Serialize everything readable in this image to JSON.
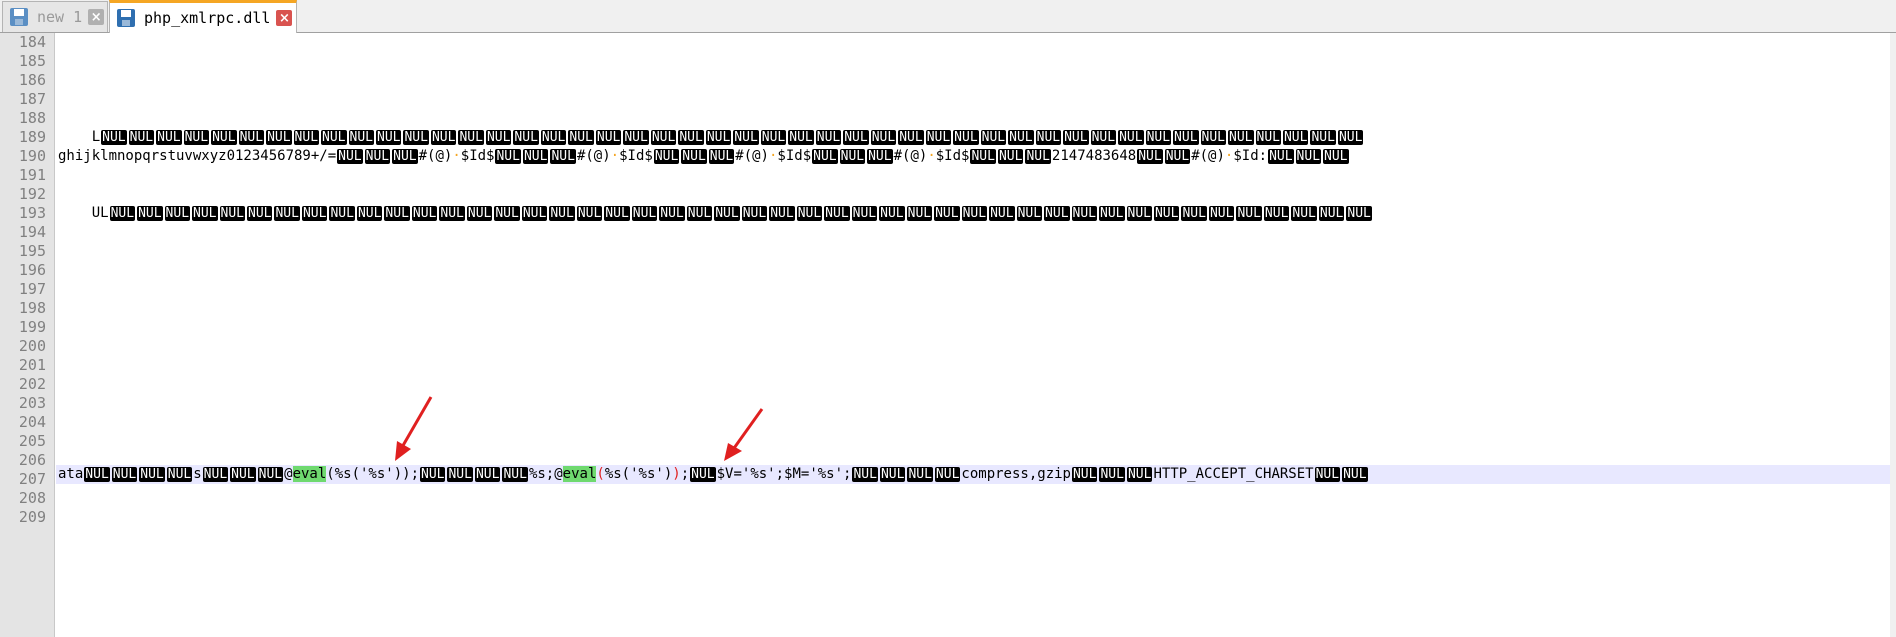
{
  "tabs": [
    {
      "label": "new 1",
      "state": "inactive"
    },
    {
      "label": "php_xmlrpc.dll",
      "state": "active"
    }
  ],
  "icons": {
    "tab_icon": "save-disk-icon",
    "tab_close": "close-icon",
    "annotation": "red-arrow-icon"
  },
  "colors": {
    "nul_bg": "#000000",
    "eval_highlight": "#6fd96f",
    "current_line": "#e8e8ff",
    "active_tab_accent": "#f5a623",
    "arrow": "#e02020"
  },
  "line_numbers": [
    "184",
    "185",
    "186",
    "187",
    "188",
    "189",
    "190",
    "191",
    "192",
    "193",
    "194",
    "195",
    "196",
    "197",
    "198",
    "199",
    "200",
    "201",
    "202",
    "203",
    "204",
    "205",
    "206",
    "207",
    "208",
    "209"
  ],
  "code": {
    "nul_token": "NUL",
    "line_188_lead": "L",
    "line_190": {
      "a": "ghijklmnopqrstuvwxyz0123456789+/=",
      "b": "#(@)",
      "c": "$Id$",
      "d": "2147483648",
      "e": "$Id:"
    },
    "line_192_lead": "UL",
    "line_207": {
      "a": "ata",
      "b": "s",
      "at": "@",
      "eval": "eval",
      "p1": "(%s('%s'));",
      "p2": "%s;@",
      "p3_open": "(",
      "p3_mid": "%s('%s')",
      "p3_close": ")",
      "p4": ";",
      "p5": "$V='%s';$M='%s';",
      "p6": "compress,gzip",
      "p7": "HTTP_ACCEPT_CHARSET"
    }
  }
}
